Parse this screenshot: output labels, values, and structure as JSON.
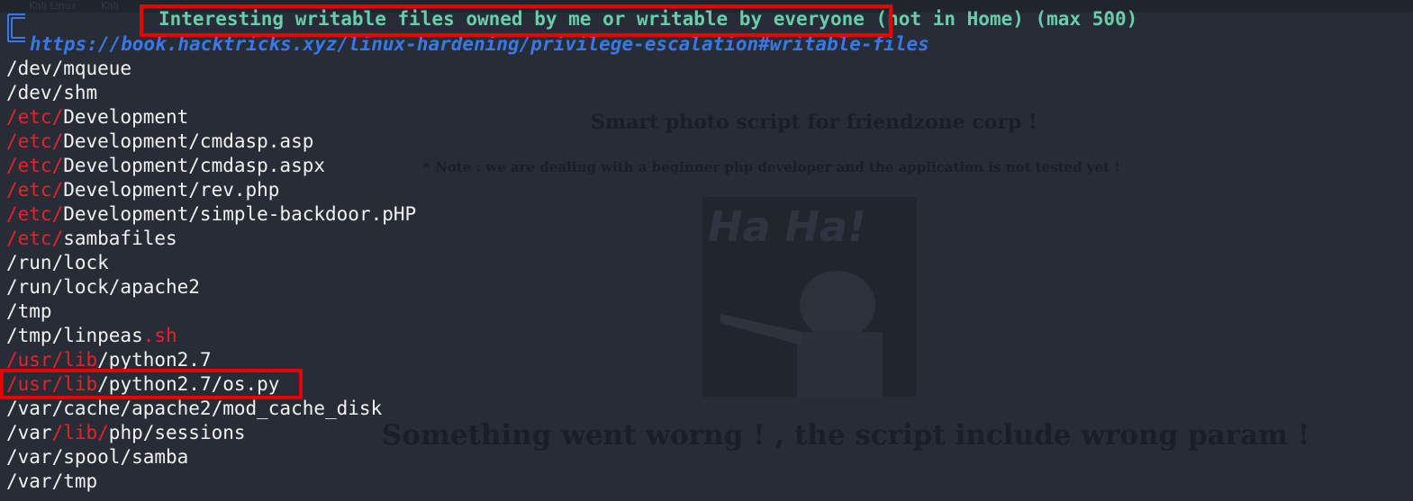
{
  "colors": {
    "terminal_bg": "#272c37",
    "header_text": "#69ccaa",
    "link_text": "#3b78e7",
    "path_text": "#f2f2f2",
    "path_highlight": "#e8222a",
    "annotation_box": "#ea0000"
  },
  "background_browser": {
    "tabs": [
      "Kali Linux",
      "Kali"
    ],
    "heading": "Smart photo script for friendzone corp !",
    "note": "* Note : we are dealing with a beginner php developer and the application is not tested yet !",
    "image_text": "Ha Ha!",
    "error": "Something went worng ! , the script include wrong param !"
  },
  "terminal": {
    "header_highlighted": "Interesting writable files owned by me or writable by everyone",
    "header_rest": " (not in Home) (max 500)",
    "link": "https://book.hacktricks.xyz/linux-hardening/privilege-escalation#writable-files",
    "paths": [
      {
        "hl": "",
        "rest": "/dev/mqueue"
      },
      {
        "hl": "",
        "rest": "/dev/shm"
      },
      {
        "hl": "/etc/",
        "rest": "Development"
      },
      {
        "hl": "/etc/",
        "rest": "Development/cmdasp.asp"
      },
      {
        "hl": "/etc/",
        "rest": "Development/cmdasp.aspx"
      },
      {
        "hl": "/etc/",
        "rest": "Development/rev.php"
      },
      {
        "hl": "/etc/",
        "rest": "Development/simple-backdoor.pHP"
      },
      {
        "hl": "/etc/",
        "rest": "sambafiles"
      },
      {
        "hl": "",
        "rest": "/run/lock"
      },
      {
        "hl": "",
        "rest": "/run/lock/apache2"
      },
      {
        "hl": "",
        "rest": "/tmp"
      },
      {
        "pre": "/tmp/linpeas",
        "hl2": ".sh"
      },
      {
        "hl": "/usr/lib",
        "rest": "/python2.7"
      },
      {
        "hl": "/usr/lib",
        "rest": "/python2.7/os.py"
      },
      {
        "hl": "",
        "rest": "/var/cache/apache2/mod_cache_disk"
      },
      {
        "pre": "/var",
        "hl2": "/lib/",
        "post": "php/sessions"
      },
      {
        "hl": "",
        "rest": "/var/spool/samba"
      },
      {
        "hl": "",
        "rest": "/var/tmp"
      }
    ]
  }
}
